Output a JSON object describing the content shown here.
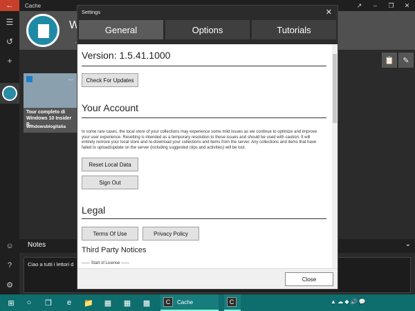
{
  "window": {
    "title": "Cache",
    "back_icon": "back-arrow-icon"
  },
  "header": {
    "title": "W",
    "subtitle": "..."
  },
  "card": {
    "title": "Tour completo di Windows 10 Insider P...",
    "source": "Windowsblogitalia",
    "menu": "..."
  },
  "notes": {
    "label": "Notes",
    "text": "Ciao a tutti i lettori d"
  },
  "dialog": {
    "title": "Settings",
    "tabs": [
      {
        "label": "General",
        "active": true
      },
      {
        "label": "Options",
        "active": false
      },
      {
        "label": "Tutorials",
        "active": false
      }
    ],
    "version": "Version: 1.5.41.1000",
    "check_updates": "Check For Updates",
    "account_heading": "Your Account",
    "account_text": "In some rare cases, the local store of your collections may experience some mild issues as we continue to optimize and improve your user experience. Resetting is intended as a temporary resolution to these issues and should be used with caution. It will entirely remove your local store and re-download your collections and items from the server. Any collections and items that have failed to upload/update on the server (including suggested clips and activities) will be lost.",
    "reset_label": "Reset Local Data",
    "signout_label": "Sign Out",
    "legal_heading": "Legal",
    "terms_label": "Terms Of Use",
    "privacy_label": "Privacy Policy",
    "third_party": "Third Party Notices",
    "license_start": "------ Start of License ------",
    "close_label": "Close"
  },
  "taskbar": {
    "app_label": "Cache",
    "app_badge": "C"
  },
  "colors": {
    "accent": "#c8402a",
    "taskbar": "#0e6d6d",
    "logo": "#1f8aa6"
  }
}
